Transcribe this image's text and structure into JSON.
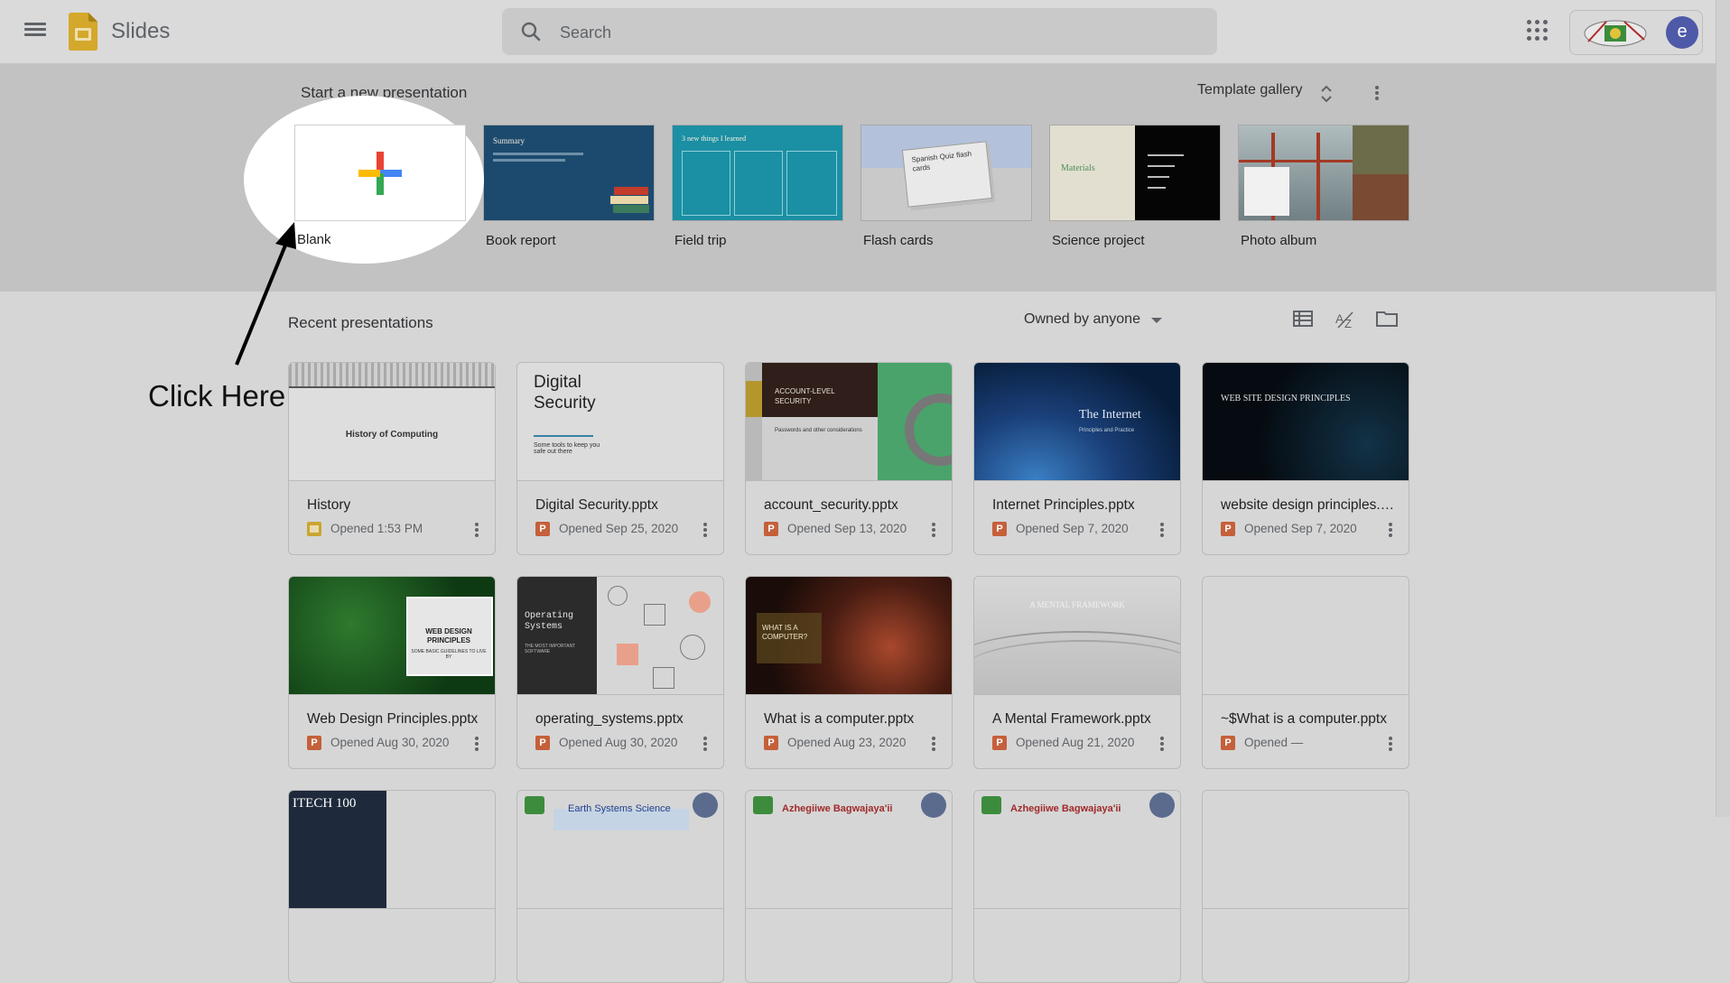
{
  "app": {
    "name": "Slides"
  },
  "search": {
    "placeholder": "Search"
  },
  "account": {
    "avatar_letter": "e"
  },
  "templates": {
    "title": "Start a new presentation",
    "gallery_label": "Template gallery",
    "items": [
      {
        "label": "Blank"
      },
      {
        "label": "Book report",
        "thumb_text": "Summary"
      },
      {
        "label": "Field trip",
        "thumb_text": "3 new things I learned"
      },
      {
        "label": "Flash cards",
        "thumb_text": "Spanish Quiz flash cards"
      },
      {
        "label": "Science project",
        "thumb_text": "Materials"
      },
      {
        "label": "Photo album"
      }
    ]
  },
  "recent": {
    "title": "Recent presentations",
    "owner_filter": "Owned by anyone",
    "cards": [
      {
        "title": "History",
        "meta": "Opened 1:53 PM",
        "type": "slides",
        "thumb_text": "History of Computing"
      },
      {
        "title": "Digital Security.pptx",
        "meta": "Opened Sep 25, 2020",
        "type": "pptx",
        "thumb_text": "Digital Security",
        "thumb_sub": "Some tools to keep you safe out there"
      },
      {
        "title": "account_security.pptx",
        "meta": "Opened Sep 13, 2020",
        "type": "pptx",
        "thumb_text": "ACCOUNT-LEVEL SECURITY",
        "thumb_sub": "Passwords and other considerations"
      },
      {
        "title": "Internet Principles.pptx",
        "meta": "Opened Sep 7, 2020",
        "type": "pptx",
        "thumb_text": "The Internet",
        "thumb_sub": "Principles and Practice"
      },
      {
        "title": "website design principles.pptx",
        "meta": "Opened Sep 7, 2020",
        "type": "pptx",
        "thumb_text": "WEB SITE DESIGN PRINCIPLES"
      },
      {
        "title": "Web Design Principles.pptx",
        "meta": "Opened Aug 30, 2020",
        "type": "pptx",
        "thumb_text": "WEB DESIGN PRINCIPLES",
        "thumb_sub": "SOME BASIC GUIDELINES TO LIVE BY"
      },
      {
        "title": "operating_systems.pptx",
        "meta": "Opened Aug 30, 2020",
        "type": "pptx",
        "thumb_text": "Operating Systems",
        "thumb_sub": "THE MOST IMPORTANT SOFTWARE"
      },
      {
        "title": "What is a computer.pptx",
        "meta": "Opened Aug 23, 2020",
        "type": "pptx",
        "thumb_text": "WHAT IS A COMPUTER?"
      },
      {
        "title": "A Mental Framework.pptx",
        "meta": "Opened Aug 21, 2020",
        "type": "pptx",
        "thumb_text": "A MENTAL FRAMEWORK"
      },
      {
        "title": "~$What is a computer.pptx",
        "meta": "Opened —",
        "type": "pptx",
        "thumb_text": ""
      },
      {
        "title": "",
        "meta": "",
        "type": "",
        "thumb_text": "ITECH 100"
      },
      {
        "title": "",
        "meta": "",
        "type": "",
        "thumb_text": "Earth Systems Science"
      },
      {
        "title": "",
        "meta": "",
        "type": "",
        "thumb_text": "Azhegiiwe Bagwajaya'ii"
      },
      {
        "title": "",
        "meta": "",
        "type": "",
        "thumb_text": "Azhegiiwe Bagwajaya'ii"
      },
      {
        "title": "",
        "meta": "",
        "type": "",
        "thumb_text": ""
      }
    ]
  },
  "annotation": {
    "text": "Click Here"
  },
  "colors": {
    "accent_purple": "#4e5aa8",
    "pptx_orange": "#c5603a",
    "slides_yellow": "#c9a531"
  }
}
